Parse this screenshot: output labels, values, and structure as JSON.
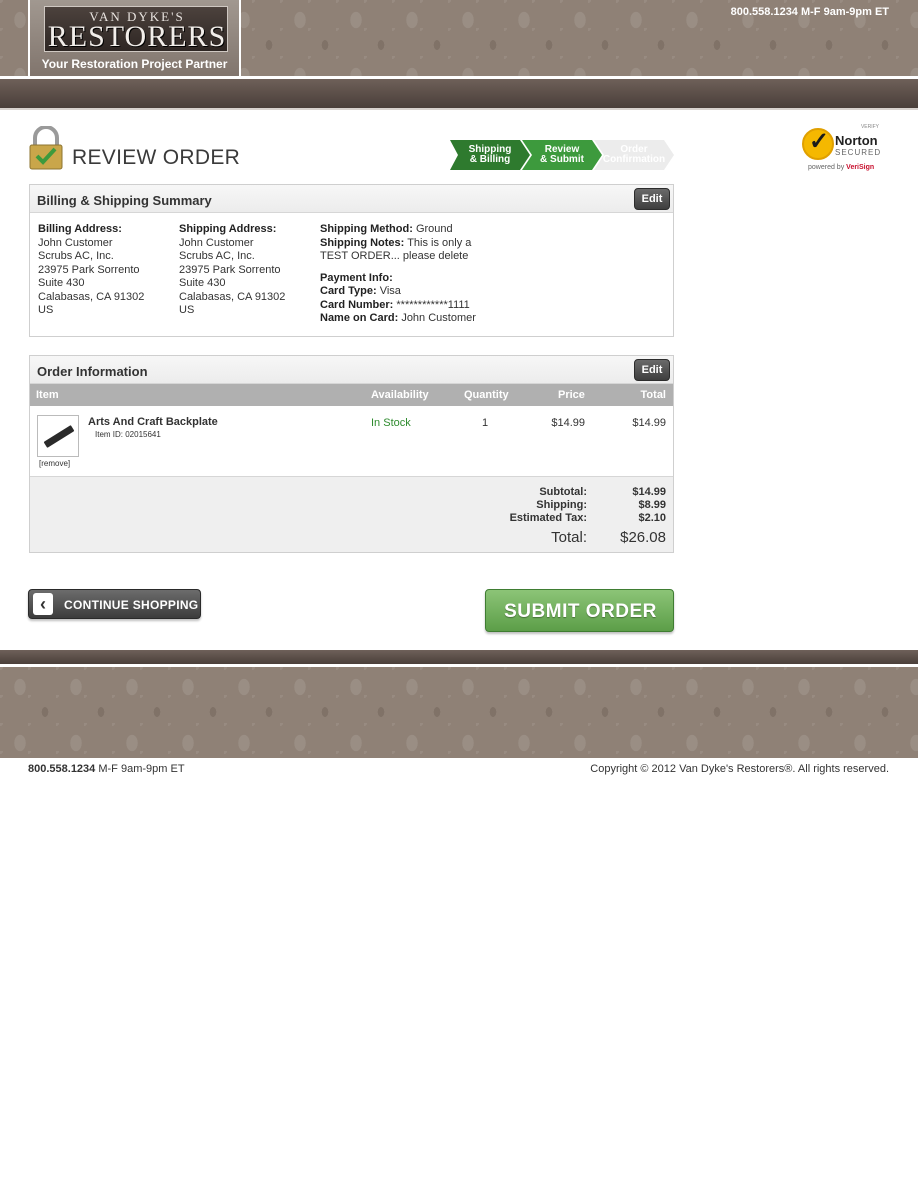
{
  "header": {
    "logo_small": "VAN DYKE'S",
    "logo_main": "RESTORERS",
    "tagline": "Your Restoration Project Partner",
    "phone": "800.558.1234 M-F 9am-9pm ET"
  },
  "page_title": "REVIEW ORDER",
  "progress": {
    "steps": [
      {
        "line1": "Shipping",
        "line2": "& Billing",
        "state": "complete"
      },
      {
        "line1": "Review",
        "line2": "& Submit",
        "state": "current"
      },
      {
        "line1": "Order",
        "line2": "Confirmation",
        "state": "upcoming"
      }
    ]
  },
  "norton": {
    "verify": "VERIFY",
    "name": "Norton",
    "secured": "SECURED",
    "powered_by": "powered by",
    "verisign": "VeriSign"
  },
  "summary": {
    "title": "Billing & Shipping Summary",
    "edit_label": "Edit",
    "billing": {
      "heading": "Billing Address:",
      "lines": [
        "John Customer",
        "Scrubs AC, Inc.",
        "23975 Park Sorrento",
        "Suite 430",
        "Calabasas,  CA  91302",
        "US"
      ]
    },
    "shipping": {
      "heading": "Shipping Address:",
      "lines": [
        "John Customer",
        "Scrubs AC, Inc.",
        "23975 Park Sorrento",
        "Suite 430",
        "Calabasas,  CA  91302",
        "US"
      ]
    },
    "method_label": "Shipping Method:",
    "method_value": "Ground",
    "notes_label": "Shipping Notes:",
    "notes_value1": "This is only a",
    "notes_value2": "TEST ORDER... please delete",
    "payment_heading": "Payment Info:",
    "card_type_label": "Card Type:",
    "card_type_value": "Visa",
    "card_number_label": "Card Number:",
    "card_number_value": "************1111",
    "name_label": "Name on Card:",
    "name_value": "John Customer"
  },
  "order": {
    "title": "Order Information",
    "edit_label": "Edit",
    "columns": [
      "Item",
      "Availability",
      "Quantity",
      "Price",
      "Total"
    ],
    "items": [
      {
        "name": "Arts And Craft Backplate",
        "id_text": "Item ID: 02015641",
        "availability": "In Stock",
        "quantity": "1",
        "price": "$14.99",
        "total": "$14.99",
        "remove_label": "[remove]"
      }
    ],
    "subtotal_label": "Subtotal:",
    "subtotal_value": "$14.99",
    "shipping_label": "Shipping:",
    "shipping_value": "$8.99",
    "tax_label": "Estimated Tax:",
    "tax_value": "$2.10",
    "total_label": "Total:",
    "total_value": "$26.08"
  },
  "buttons": {
    "continue_label": "CONTINUE SHOPPING",
    "submit_label": "SUBMIT ORDER"
  },
  "footer": {
    "phone_number": "800.558.1234",
    "phone_hours": "M-F 9am-9pm ET",
    "copyright": "Copyright © 2012 Van Dyke's Restorers®. All rights reserved."
  },
  "colors": {
    "step_complete": "#2e7a2e",
    "step_current": "#3d9a3d",
    "in_stock": "#2e8b2e",
    "submit_green": "#6fb05a"
  }
}
